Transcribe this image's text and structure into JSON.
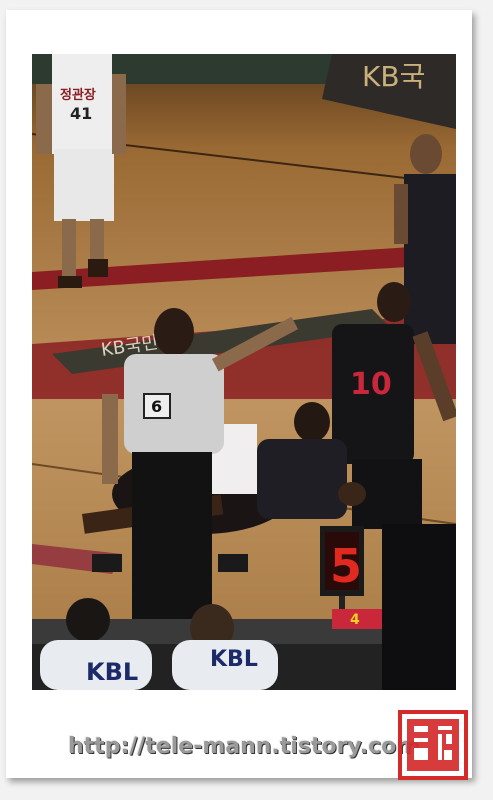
{
  "photo": {
    "banner_text": "KB국",
    "player_name": "정관장",
    "player_number": "41",
    "referee_number": "6",
    "opponent_number": "10",
    "shot_clock_value": "5",
    "table_label_left": "KBL",
    "table_label_right": "KBL",
    "floor_logo": "KB국민카드",
    "table_number": "4"
  },
  "caption": {
    "url": "http://tele-mann.tistory.com",
    "seal_chars": [
      "텔",
      "레",
      "만"
    ]
  },
  "colors": {
    "seal": "#d42a2a",
    "court": "#b8854a",
    "court_band": "#8a1e22",
    "shot_clock": "#e02a20"
  }
}
